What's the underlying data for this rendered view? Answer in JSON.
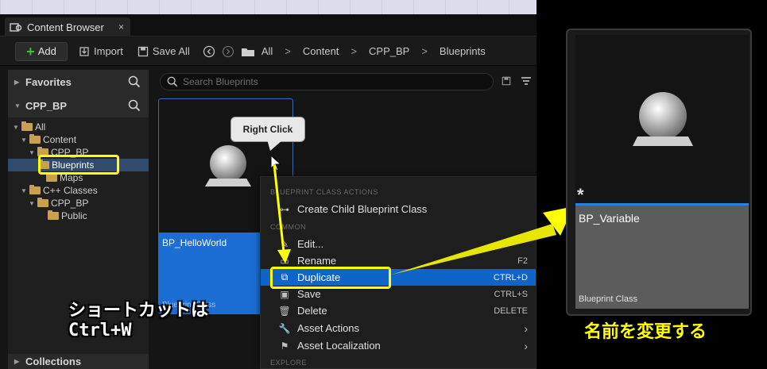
{
  "window": {
    "tab_title": "Content Browser",
    "tab_close": "×"
  },
  "toolbar": {
    "add_label": "Add",
    "import_label": "Import",
    "save_all_label": "Save All",
    "breadcrumbs": [
      "All",
      "Content",
      "CPP_BP",
      "Blueprints"
    ]
  },
  "sidebar": {
    "favorites_label": "Favorites",
    "project_label": "CPP_BP",
    "tree": [
      "All",
      "Content",
      "CPP_BP",
      "Blueprints",
      "Maps",
      "C++ Classes",
      "CPP_BP",
      "Public"
    ],
    "collections_label": "Collections"
  },
  "assets": {
    "search_placeholder": "Search Blueprints",
    "items": [
      {
        "name": "BP_HelloWorld",
        "class": "Blueprint Class"
      }
    ]
  },
  "callout": {
    "label": "Right Click"
  },
  "context_menu": {
    "section_blueprint": "BLUEPRINT CLASS ACTIONS",
    "create_child": "Create Child Blueprint Class",
    "section_common": "COMMON",
    "edit": "Edit...",
    "rename": "Rename",
    "rename_shortcut": "F2",
    "duplicate": "Duplicate",
    "duplicate_shortcut": "CTRL+D",
    "save": "Save",
    "save_shortcut": "CTRL+S",
    "delete": "Delete",
    "delete_shortcut": "DELETE",
    "asset_actions": "Asset Actions",
    "asset_localization": "Asset Localization",
    "section_explore": "EXPLORE"
  },
  "annotation": {
    "shortcut_line1": "ショートカットは",
    "shortcut_line2": "Ctrl+W",
    "rename_caption": "名前を変更する"
  },
  "preview": {
    "name": "BP_Variable",
    "class": "Blueprint Class",
    "dirty_marker": "*"
  },
  "colors": {
    "highlight_blue": "#0f64c8",
    "annotation_yellow": "#ffff00",
    "add_green": "#3fbf3f"
  }
}
